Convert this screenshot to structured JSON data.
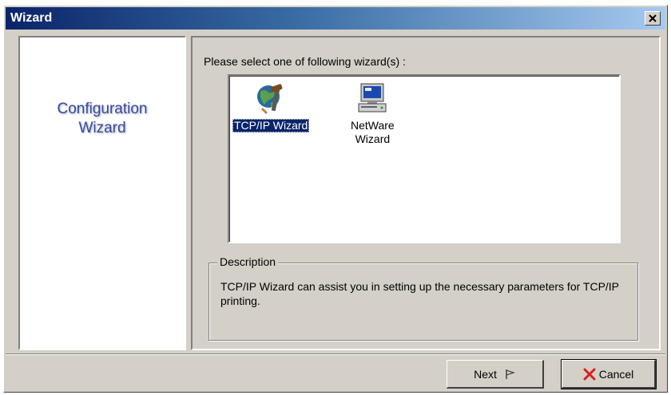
{
  "window": {
    "title": "Wizard"
  },
  "sidebar": {
    "title_line1": "Configuration",
    "title_line2": "Wizard"
  },
  "main": {
    "prompt": "Please select one of following wizard(s) :",
    "wizards": [
      {
        "label": "TCP/IP Wizard",
        "icon": "globe-tools-icon",
        "selected": true
      },
      {
        "label_line1": "NetWare",
        "label_line2": "Wizard",
        "icon": "computer-icon",
        "selected": false
      }
    ],
    "description": {
      "legend": "Description",
      "text": "TCP/IP Wizard can assist you in setting up the necessary parameters for TCP/IP printing."
    }
  },
  "buttons": {
    "next_label": "Next",
    "next_icon": "flag-icon",
    "cancel_label": "Cancel",
    "cancel_icon": "red-x-icon"
  },
  "colors": {
    "title_bar": "#0a246a",
    "selection": "#0a246a",
    "sidebar_text": "#3a4a92",
    "cancel_x": "#d42020"
  }
}
